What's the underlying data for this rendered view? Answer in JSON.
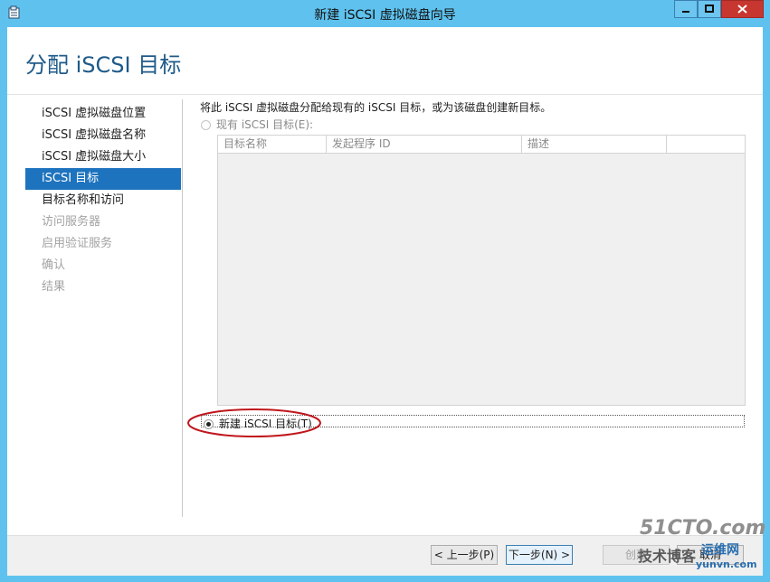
{
  "window": {
    "title": "新建 iSCSI 虚拟磁盘向导"
  },
  "page": {
    "title": "分配 iSCSI 目标",
    "description": "将此 iSCSI 虚拟磁盘分配给现有的 iSCSI 目标，或为该磁盘创建新目标。"
  },
  "nav": {
    "items": [
      {
        "label": "iSCSI 虚拟磁盘位置",
        "state": "normal"
      },
      {
        "label": "iSCSI 虚拟磁盘名称",
        "state": "normal"
      },
      {
        "label": "iSCSI 虚拟磁盘大小",
        "state": "normal"
      },
      {
        "label": "iSCSI 目标",
        "state": "active"
      },
      {
        "label": "目标名称和访问",
        "state": "normal"
      },
      {
        "label": "访问服务器",
        "state": "disabled"
      },
      {
        "label": "启用验证服务",
        "state": "disabled"
      },
      {
        "label": "确认",
        "state": "disabled"
      },
      {
        "label": "结果",
        "state": "disabled"
      }
    ]
  },
  "existing_target": {
    "label": "现有 iSCSI 目标(E):",
    "selected": false
  },
  "table": {
    "columns": [
      "目标名称",
      "发起程序 ID",
      "描述",
      ""
    ]
  },
  "new_target": {
    "label": "新建 iSCSI 目标(T)",
    "selected": true
  },
  "footer": {
    "prev": "< 上一步(P)",
    "next": "下一步(N) >",
    "create": "创建",
    "cancel": "取消"
  },
  "watermark": {
    "line1": "51CTO.com",
    "line2": "技术博客",
    "line3": "运维网",
    "line4": "yunvn.com"
  },
  "colors": {
    "titlebar": "#5fc2ee",
    "accent": "#1e73be",
    "title_text": "#1e5a89",
    "highlight_ring": "#c0161c"
  }
}
